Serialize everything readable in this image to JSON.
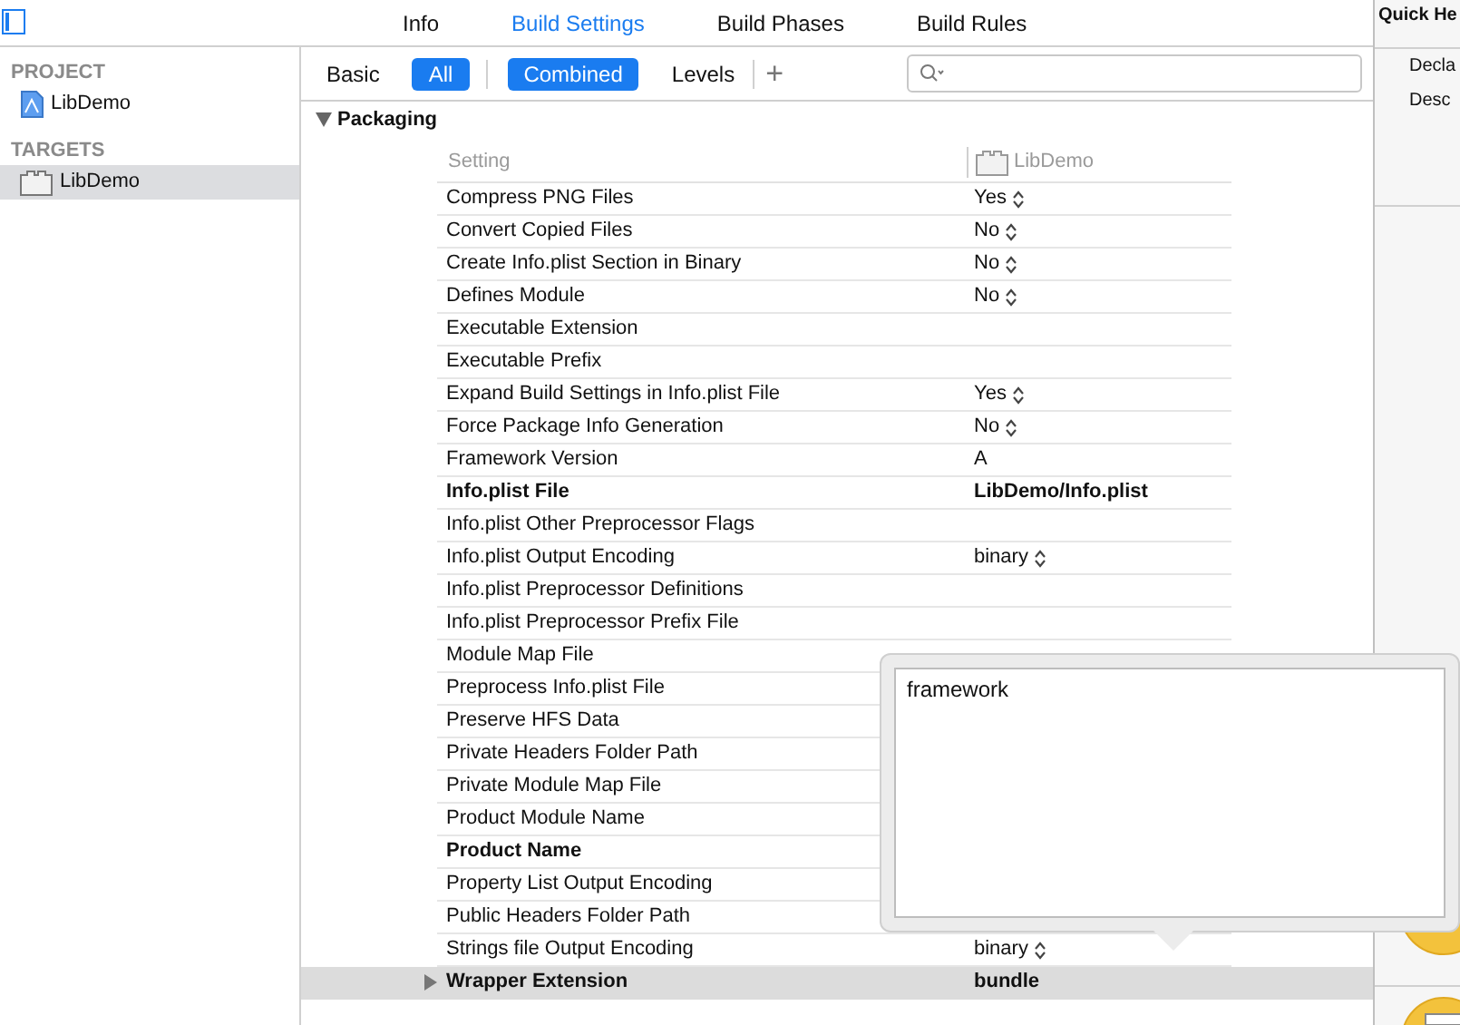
{
  "tabs": [
    {
      "label": "Info",
      "selected": false
    },
    {
      "label": "Build Settings",
      "selected": true
    },
    {
      "label": "Build Phases",
      "selected": false
    },
    {
      "label": "Build Rules",
      "selected": false
    }
  ],
  "sidebar": {
    "sections": [
      {
        "title": "PROJECT",
        "items": [
          {
            "label": "LibDemo",
            "kind": "project",
            "selected": false
          }
        ]
      },
      {
        "title": "TARGETS",
        "items": [
          {
            "label": "LibDemo",
            "kind": "target",
            "selected": true
          }
        ]
      }
    ]
  },
  "filters": [
    {
      "label": "Basic",
      "selected": false
    },
    {
      "label": "All",
      "selected": true
    }
  ],
  "views": [
    {
      "label": "Combined",
      "selected": true
    },
    {
      "label": "Levels",
      "selected": false
    }
  ],
  "add_button": "+",
  "section": {
    "title": "Packaging",
    "expanded": true
  },
  "columns": {
    "setting": "Setting",
    "target": "LibDemo"
  },
  "rows": [
    {
      "label": "Compress PNG Files",
      "value": "Yes",
      "stepper": true,
      "bold": false,
      "selected": false
    },
    {
      "label": "Convert Copied Files",
      "value": "No",
      "stepper": true,
      "bold": false,
      "selected": false
    },
    {
      "label": "Create Info.plist Section in Binary",
      "value": "No",
      "stepper": true,
      "bold": false,
      "selected": false
    },
    {
      "label": "Defines Module",
      "value": "No",
      "stepper": true,
      "bold": false,
      "selected": false
    },
    {
      "label": "Executable Extension",
      "bold": false,
      "selected": false
    },
    {
      "label": "Executable Prefix",
      "bold": false,
      "selected": false
    },
    {
      "label": "Expand Build Settings in Info.plist File",
      "value": "Yes",
      "stepper": true,
      "bold": false,
      "selected": false
    },
    {
      "label": "Force Package Info Generation",
      "value": "No",
      "stepper": true,
      "bold": false,
      "selected": false
    },
    {
      "label": "Framework Version",
      "value": "A",
      "stepper": false,
      "bold": false,
      "selected": false
    },
    {
      "label": "Info.plist File",
      "value": "LibDemo/Info.plist",
      "stepper": false,
      "bold": true,
      "selected": false
    },
    {
      "label": "Info.plist Other Preprocessor Flags",
      "bold": false,
      "selected": false
    },
    {
      "label": "Info.plist Output Encoding",
      "value": "binary",
      "stepper": true,
      "bold": false,
      "selected": false
    },
    {
      "label": "Info.plist Preprocessor Definitions",
      "bold": false,
      "selected": false
    },
    {
      "label": "Info.plist Preprocessor Prefix File",
      "bold": false,
      "selected": false
    },
    {
      "label": "Module Map File",
      "bold": false,
      "selected": false
    },
    {
      "label": "Preprocess Info.plist File",
      "bold": false,
      "selected": false
    },
    {
      "label": "Preserve HFS Data",
      "bold": false,
      "selected": false
    },
    {
      "label": "Private Headers Folder Path",
      "bold": false,
      "selected": false
    },
    {
      "label": "Private Module Map File",
      "bold": false,
      "selected": false
    },
    {
      "label": "Product Module Name",
      "bold": false,
      "selected": false
    },
    {
      "label": "Product Name",
      "bold": true,
      "selected": false
    },
    {
      "label": "Property List Output Encoding",
      "bold": false,
      "selected": false
    },
    {
      "label": "Public Headers Folder Path",
      "bold": false,
      "selected": false
    },
    {
      "label": "Strings file Output Encoding",
      "value": "binary",
      "stepper": true,
      "bold": false,
      "selected": false
    },
    {
      "label": "Wrapper Extension",
      "value": "bundle",
      "stepper": false,
      "bold": true,
      "selected": true,
      "expandable": true
    }
  ],
  "popover": {
    "value": "framework"
  },
  "inspector": {
    "title": "Quick He",
    "items": [
      "Decla",
      "Desc"
    ]
  }
}
